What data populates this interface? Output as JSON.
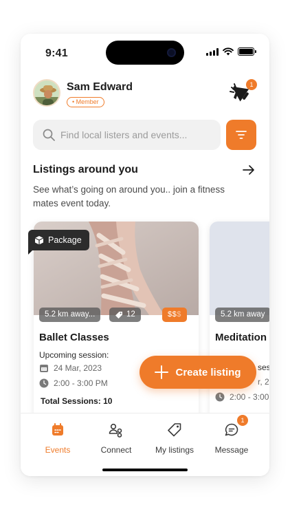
{
  "status_bar": {
    "time": "9:41"
  },
  "user": {
    "name": "Sam Edward",
    "badge": "• Member"
  },
  "notifications": {
    "count": "1"
  },
  "search": {
    "placeholder": "Find local listers and events..."
  },
  "section": {
    "title": "Listings around you",
    "description": "See what’s going on around you.. join a fitness mates event today."
  },
  "listings": [
    {
      "package_label": "Package",
      "distance": "5.2 km away...",
      "tag_count": "12",
      "price_active": "$$",
      "price_inactive": "$",
      "title": "Ballet Classes",
      "subtitle": "Upcoming session:",
      "date": "24 Mar, 2023",
      "time": "2:00 - 3:00 PM",
      "total_sessions": "Total Sessions: 10"
    },
    {
      "distance": "5.2 km away",
      "title": "Meditation",
      "subtitle_fragment": "ses",
      "date_fragment": "r, 20",
      "time": "2:00 - 3:00"
    }
  ],
  "fab": {
    "label": "Create listing"
  },
  "bottom_nav": {
    "items": [
      {
        "label": "Events",
        "icon": "calendar-icon",
        "active": true
      },
      {
        "label": "Connect",
        "icon": "people-icon",
        "active": false
      },
      {
        "label": "My listings",
        "icon": "tag-icon",
        "active": false
      },
      {
        "label": "Message",
        "icon": "chat-icon",
        "active": false,
        "badge": "1"
      }
    ]
  },
  "colors": {
    "accent": "#ef7b2a",
    "dark_label": "#2c2c2c",
    "search_bg": "#f1f1f1"
  }
}
